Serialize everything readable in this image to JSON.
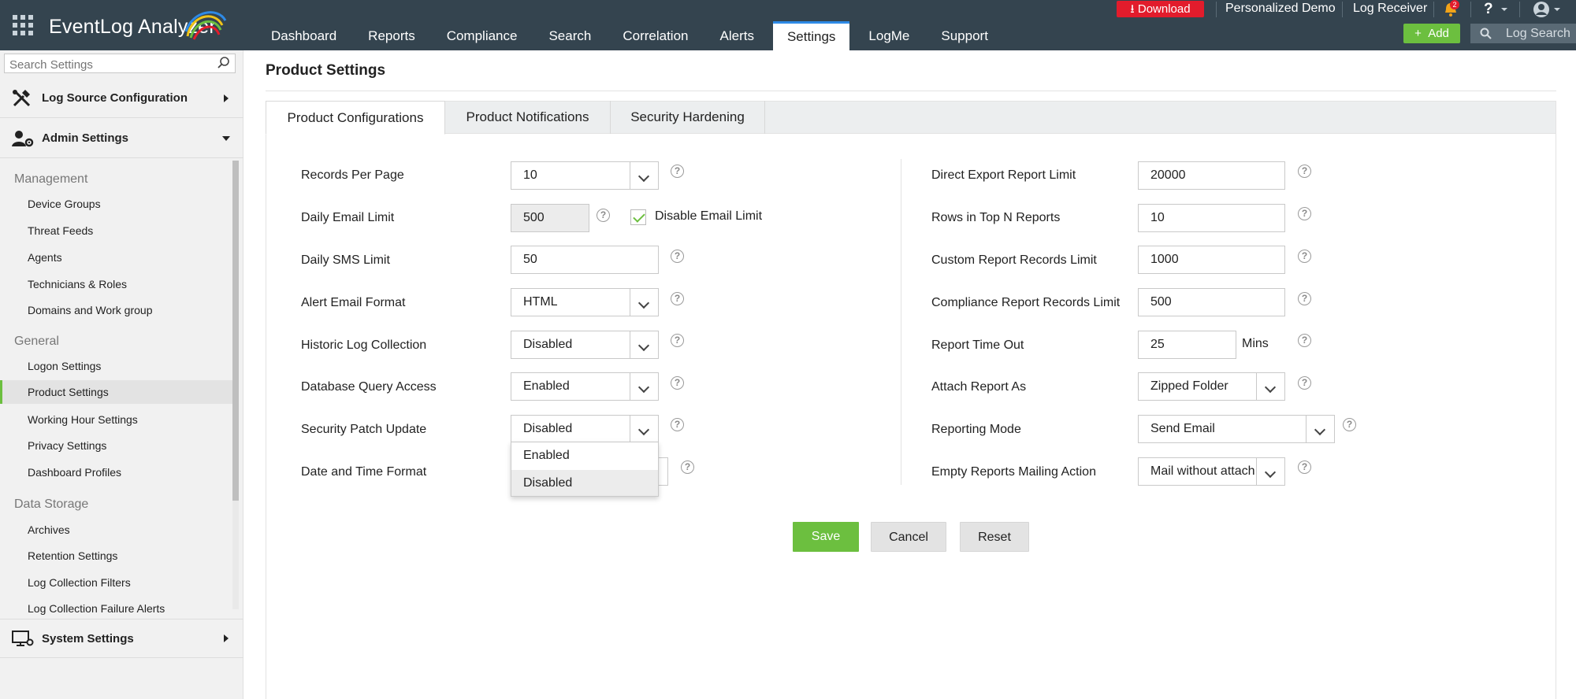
{
  "app": {
    "name": "EventLog Analyzer"
  },
  "topnav": {
    "tabs": [
      "Dashboard",
      "Reports",
      "Compliance",
      "Search",
      "Correlation",
      "Alerts",
      "Settings",
      "LogMe",
      "Support"
    ],
    "active": "Settings"
  },
  "topright": {
    "download": "Download",
    "demo": "Personalized Demo",
    "receiver": "Log Receiver",
    "notif_count": "2",
    "help": "?",
    "add": "Add",
    "log_search": "Log Search"
  },
  "sidebar": {
    "search_placeholder": "Search Settings",
    "log_source": "Log Source Configuration",
    "admin": "Admin Settings",
    "groups": {
      "management": "Management",
      "general": "General",
      "data_storage": "Data Storage"
    },
    "management_items": [
      "Device Groups",
      "Threat Feeds",
      "Agents",
      "Technicians & Roles",
      "Domains and Work group"
    ],
    "general_items": [
      "Logon Settings",
      "Product Settings",
      "Working Hour Settings",
      "Privacy Settings",
      "Dashboard Profiles"
    ],
    "storage_items": [
      "Archives",
      "Retention Settings",
      "Log Collection Filters",
      "Log Collection Failure Alerts"
    ],
    "system": "System Settings",
    "active_item": "Product Settings"
  },
  "page": {
    "title": "Product Settings",
    "tabs": [
      "Product Configurations",
      "Product Notifications",
      "Security Hardening"
    ],
    "active_tab": "Product Configurations"
  },
  "left_form": {
    "records_per_page": {
      "label": "Records Per Page",
      "value": "10"
    },
    "daily_email_limit": {
      "label": "Daily Email Limit",
      "value": "500",
      "checkbox_label": "Disable Email Limit",
      "checked": true
    },
    "daily_sms_limit": {
      "label": "Daily SMS Limit",
      "value": "50"
    },
    "alert_email_format": {
      "label": "Alert Email Format",
      "value": "HTML"
    },
    "historic_log": {
      "label": "Historic Log Collection",
      "value": "Disabled"
    },
    "db_query": {
      "label": "Database Query Access",
      "value": "Enabled"
    },
    "security_patch": {
      "label": "Security Patch Update",
      "value": "Disabled"
    },
    "date_time": {
      "label": "Date and Time Format"
    }
  },
  "dropdown": {
    "options": [
      "Enabled",
      "Disabled"
    ],
    "highlighted": "Disabled"
  },
  "right_form": {
    "direct_export": {
      "label": "Direct Export Report Limit",
      "value": "20000"
    },
    "rows_top_n": {
      "label": "Rows in Top N Reports",
      "value": "10"
    },
    "custom_report": {
      "label": "Custom Report Records Limit",
      "value": "1000"
    },
    "compliance_report": {
      "label": "Compliance Report Records Limit",
      "value": "500"
    },
    "report_timeout": {
      "label": "Report Time Out",
      "value": "25",
      "unit": "Mins"
    },
    "attach_report": {
      "label": "Attach Report As",
      "value": "Zipped Folder"
    },
    "reporting_mode": {
      "label": "Reporting Mode",
      "value": "Send Email"
    },
    "empty_reports": {
      "label": "Empty Reports Mailing Action",
      "value": "Mail without attach"
    }
  },
  "buttons": {
    "save": "Save",
    "cancel": "Cancel",
    "reset": "Reset"
  },
  "colors": {
    "topbar": "#34444f",
    "accent_green": "#6cbf3f",
    "download_red": "#e21c2c",
    "active_tab_blue": "#2e8ae6"
  }
}
